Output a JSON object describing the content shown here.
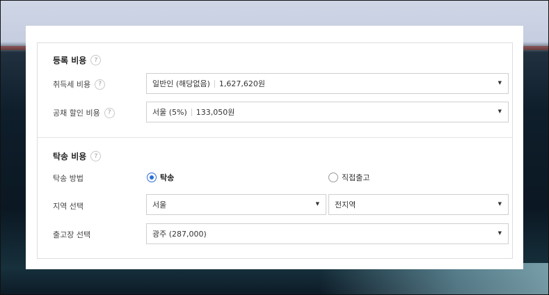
{
  "registration": {
    "title": "등록 비용",
    "help_icon": "?",
    "acquisition_tax": {
      "label": "취득세 비용",
      "selected_option": "일반인 (해당없음)",
      "selected_amount": "1,627,620원"
    },
    "bond_discount": {
      "label": "공채 할인 비용",
      "selected_option": "서울 (5%)",
      "selected_amount": "133,050원"
    }
  },
  "delivery": {
    "title": "탁송 비용",
    "help_icon": "?",
    "method": {
      "label": "탁송 방법",
      "options": [
        {
          "label": "탁송",
          "checked": true
        },
        {
          "label": "직접출고",
          "checked": false
        }
      ]
    },
    "region": {
      "label": "지역 선택",
      "primary_value": "서울",
      "secondary_value": "전지역"
    },
    "depot": {
      "label": "출고장 선택",
      "selected_value": "광주 (287,000)"
    }
  },
  "icons": {
    "caret": "▼",
    "help": "question-circle-icon"
  },
  "colors": {
    "accent": "#2a6fd6",
    "border": "#cfcfcf"
  }
}
